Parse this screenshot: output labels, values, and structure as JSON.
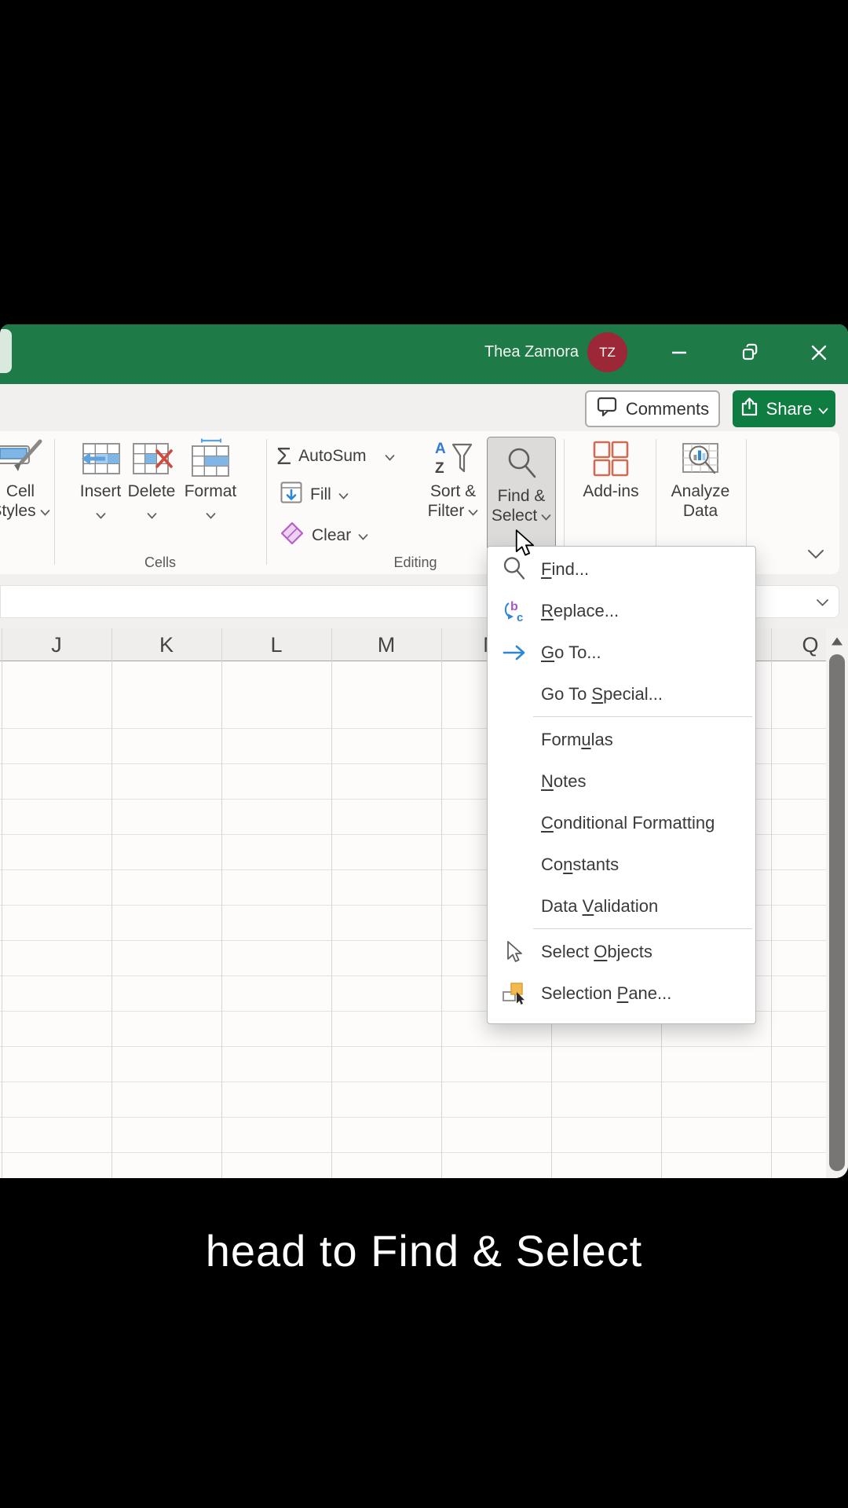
{
  "caption": "head to Find & Select",
  "titlebar": {
    "user_name": "Thea Zamora",
    "avatar_initials": "TZ"
  },
  "actions": {
    "comments": "Comments",
    "share": "Share"
  },
  "ribbon": {
    "groups": {
      "cells": "Cells",
      "editing": "Editing"
    },
    "cell_styles": {
      "line1": "Cell",
      "line2": "Styles",
      "icon": "brush-icon"
    },
    "insert": {
      "label": "Insert",
      "icon": "insert-cells-icon"
    },
    "delete": {
      "label": "Delete",
      "icon": "delete-cells-icon"
    },
    "format": {
      "label": "Format",
      "icon": "format-cells-icon"
    },
    "autosum": {
      "label": "AutoSum",
      "sigma": "Σ",
      "icon": "sigma-icon"
    },
    "fill": {
      "label": "Fill",
      "icon": "fill-down-icon"
    },
    "clear": {
      "label": "Clear",
      "icon": "eraser-icon"
    },
    "sort_filter": {
      "line1": "Sort &",
      "line2": "Filter",
      "icon": "sort-filter-icon"
    },
    "find_select": {
      "line1": "Find &",
      "line2": "Select",
      "icon": "magnifier-icon"
    },
    "addins": {
      "label": "Add-ins",
      "icon": "addins-grid-icon"
    },
    "analyze": {
      "line1": "Analyze",
      "line2": "Data",
      "icon": "analyze-data-icon"
    }
  },
  "menu": {
    "items": [
      {
        "pre": "",
        "key": "F",
        "post": "ind...",
        "icon": "magnifier-icon"
      },
      {
        "pre": "",
        "key": "R",
        "post": "eplace...",
        "icon": "replace-icon"
      },
      {
        "pre": "",
        "key": "G",
        "post": "o To...",
        "icon": "arrow-right-icon"
      },
      {
        "pre": "Go To ",
        "key": "S",
        "post": "pecial...",
        "icon": ""
      },
      {
        "pre": "Form",
        "key": "u",
        "post": "las",
        "icon": ""
      },
      {
        "pre": "",
        "key": "N",
        "post": "otes",
        "icon": ""
      },
      {
        "pre": "",
        "key": "C",
        "post": "onditional Formatting",
        "icon": ""
      },
      {
        "pre": "Co",
        "key": "n",
        "post": "stants",
        "icon": ""
      },
      {
        "pre": "Data ",
        "key": "V",
        "post": "alidation",
        "icon": ""
      },
      {
        "pre": "Select ",
        "key": "O",
        "post": "bjects",
        "icon": "select-cursor-icon"
      },
      {
        "pre": "Selection ",
        "key": "P",
        "post": "ane...",
        "icon": "selection-pane-icon"
      }
    ]
  },
  "sheet": {
    "columns": [
      "J",
      "K",
      "L",
      "M",
      "N",
      "Q"
    ]
  },
  "colors": {
    "titlebar_green": "#1e7a46",
    "share_green": "#0f7c41",
    "avatar_red": "#9b2737",
    "accent_blue": "#2e86d6",
    "addins_orange": "#c96e54",
    "clear_purple": "#b55fc8",
    "selection_pane_orange": "#f3b94e"
  }
}
